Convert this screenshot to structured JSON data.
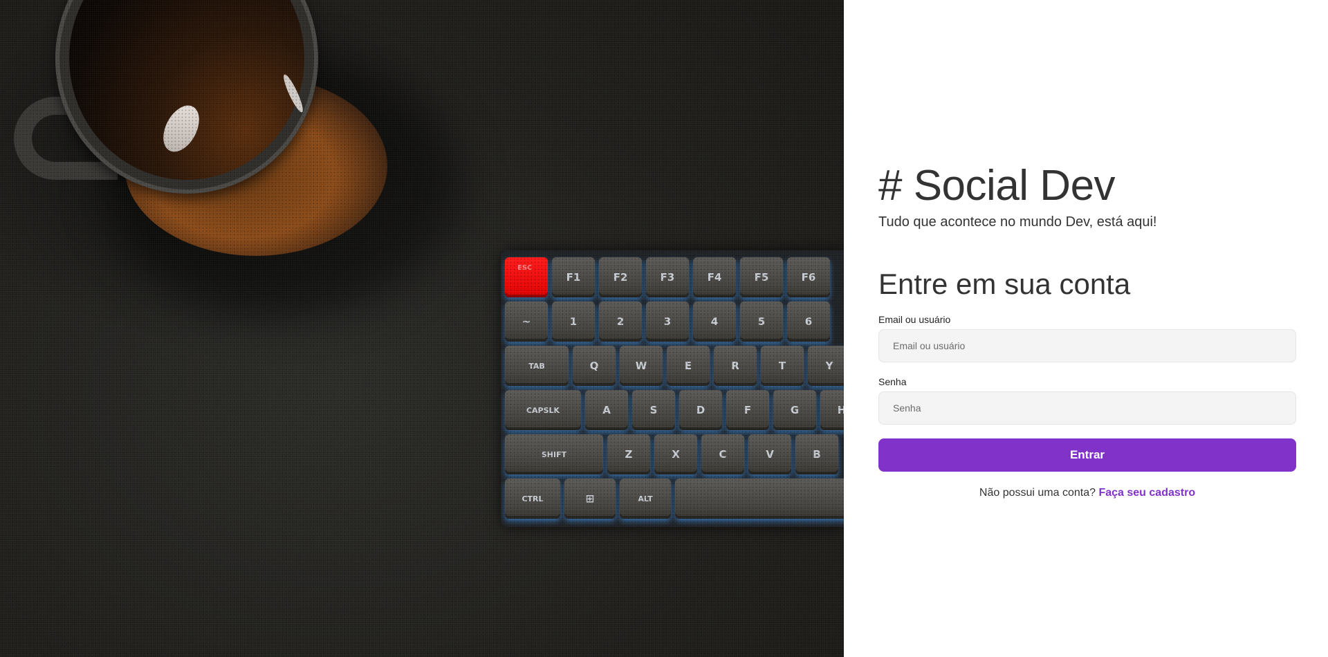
{
  "colors": {
    "accent": "#8132c9",
    "text": "#333333",
    "input_bg": "#f4f4f4",
    "panel_bg": "#ffffff"
  },
  "hero": {
    "image_subject": "coffee mug and backlit mechanical keyboard on dark desk mat",
    "keyboard": {
      "row1": [
        "ESC",
        "F1",
        "F2",
        "F3",
        "F4",
        "F5",
        "F6"
      ],
      "row2": [
        "~",
        "1",
        "2",
        "3",
        "4",
        "5",
        "6"
      ],
      "row3": [
        "TAB",
        "Q",
        "W",
        "E",
        "R",
        "T",
        "Y"
      ],
      "row4": [
        "CAPSLK",
        "A",
        "S",
        "D",
        "F",
        "G",
        "H"
      ],
      "row5": [
        "SHIFT",
        "Z",
        "X",
        "C",
        "V",
        "B"
      ],
      "row6": [
        "CTRL",
        "⊞",
        "ALT",
        ""
      ]
    }
  },
  "brand": {
    "title": "# Social Dev",
    "subtitle": "Tudo que acontece no mundo Dev, está aqui!"
  },
  "form": {
    "title": "Entre em sua conta",
    "email_label": "Email ou usuário",
    "email_placeholder": "Email ou usuário",
    "email_value": "",
    "password_label": "Senha",
    "password_placeholder": "Senha",
    "password_value": "",
    "submit_label": "Entrar",
    "signup_prompt": "Não possui uma conta?",
    "signup_link": "Faça seu cadastro"
  }
}
